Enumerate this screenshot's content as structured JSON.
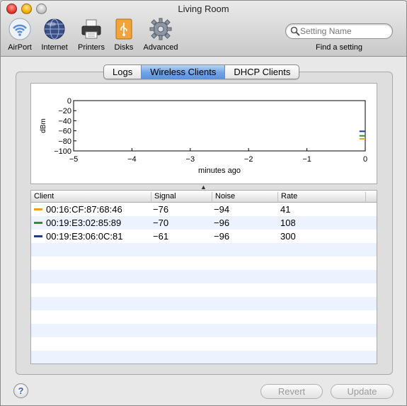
{
  "window": {
    "title": "Living Room"
  },
  "toolbar": {
    "items": [
      {
        "label": "AirPort",
        "icon": "airport-icon"
      },
      {
        "label": "Internet",
        "icon": "globe-icon"
      },
      {
        "label": "Printers",
        "icon": "printer-icon"
      },
      {
        "label": "Disks",
        "icon": "usb-disk-icon"
      },
      {
        "label": "Advanced",
        "icon": "gear-icon"
      }
    ],
    "search": {
      "placeholder": "Setting Name",
      "label": "Find a setting"
    }
  },
  "tabs": [
    {
      "label": "Logs",
      "selected": false
    },
    {
      "label": "Wireless Clients",
      "selected": true
    },
    {
      "label": "DHCP Clients",
      "selected": false
    }
  ],
  "chart_data": {
    "type": "line",
    "title": "",
    "xlabel": "minutes ago",
    "ylabel": "dBm",
    "xlim": [
      -5,
      0
    ],
    "ylim": [
      -100,
      0
    ],
    "x_ticks": [
      "−5",
      "−4",
      "−3",
      "−2",
      "−1",
      "0"
    ],
    "y_ticks": [
      "0",
      "−20",
      "−40",
      "−60",
      "−80",
      "−100"
    ],
    "series": [
      {
        "color": "#f0a020",
        "x": [
          -0.1,
          0
        ],
        "y": [
          -76,
          -76
        ]
      },
      {
        "color": "#2e8b3a",
        "x": [
          -0.1,
          0
        ],
        "y": [
          -70,
          -70
        ]
      },
      {
        "color": "#1f3f7f",
        "x": [
          -0.1,
          0
        ],
        "y": [
          -61,
          -61
        ]
      }
    ]
  },
  "table": {
    "columns": [
      "Client",
      "Signal",
      "Noise",
      "Rate"
    ],
    "rows": [
      {
        "client": "00:16:CF:87:68:46",
        "signal": "−76",
        "noise": "−94",
        "rate": "41",
        "color": "#f0a020"
      },
      {
        "client": "00:19:E3:02:85:89",
        "signal": "−70",
        "noise": "−96",
        "rate": "108",
        "color": "#2e8b3a"
      },
      {
        "client": "00:19:E3:06:0C:81",
        "signal": "−61",
        "noise": "−96",
        "rate": "300",
        "color": "#1f3f7f"
      }
    ]
  },
  "buttons": {
    "help": "?",
    "revert": "Revert",
    "update": "Update"
  }
}
